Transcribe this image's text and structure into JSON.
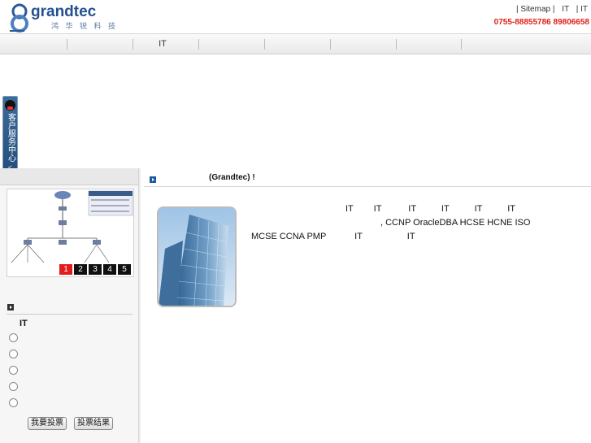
{
  "header": {
    "logo_text": "grandtec",
    "logo_sub": "鸿 华 锐 科 技",
    "links": [
      "| Sitemap |",
      "IT",
      "| IT"
    ],
    "phone": "0755-88855786 89806658"
  },
  "nav": {
    "items": [
      "",
      "",
      "IT",
      "",
      "",
      "",
      "",
      "",
      ""
    ]
  },
  "qq": {
    "label": "客户服务中心"
  },
  "diagram": {
    "pages": [
      "1",
      "2",
      "3",
      "4",
      "5"
    ],
    "active_page": "1"
  },
  "poll": {
    "title": "IT",
    "options": [
      "",
      "",
      "",
      "",
      ""
    ],
    "vote_button": "我要投票",
    "result_button": "投票结果"
  },
  "main": {
    "title": "(Grandtec)    !",
    "intro_line1": [
      "IT",
      "IT",
      "IT",
      "IT",
      "IT",
      "IT"
    ],
    "intro_line2": ",    CCNP OracleDBA HCSE HCNE ISO",
    "intro_line3": [
      "MCSE CCNA PMP",
      "IT",
      "IT"
    ]
  },
  "colors": {
    "accent_blue": "#1c5a9e",
    "phone_red": "#e0201b",
    "active_page": "#e21b1b"
  }
}
